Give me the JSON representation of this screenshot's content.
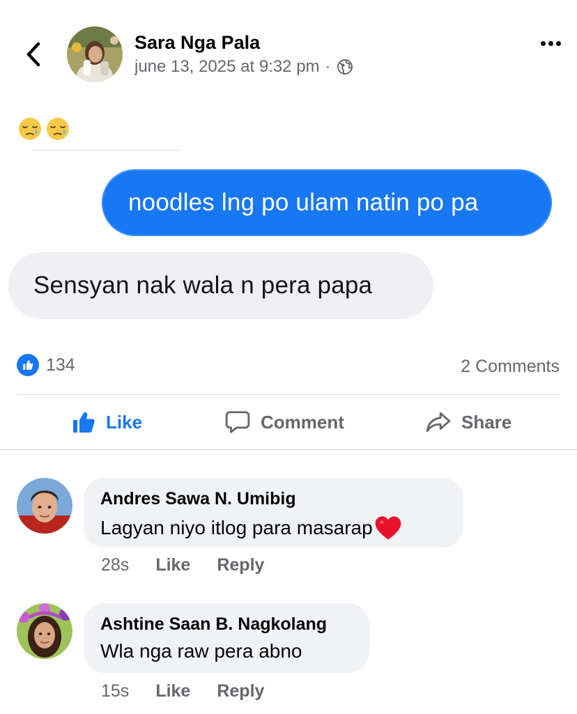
{
  "post": {
    "author_name": "Sara Nga Pala",
    "timestamp": "june 13, 2025 at 9:32 pm",
    "separator": "·",
    "privacy_icon": "globe-icon",
    "text_emojis": [
      "sleepy-face-emoji",
      "sleepy-face-emoji"
    ],
    "image_message_sent": "noodles lng po ulam natin po pa",
    "image_message_received": "Sensyan nak wala n pera papa"
  },
  "reactions": {
    "like_count": "134",
    "comment_count": "2 Comments"
  },
  "actions": {
    "like_label": "Like",
    "comment_label": "Comment",
    "share_label": "Share"
  },
  "comments": [
    {
      "author": "Andres Sawa N. Umibig",
      "text": "Lagyan niyo itlog para masarap",
      "emoji": "red-heart-emoji",
      "time": "28s",
      "like_label": "Like",
      "reply_label": "Reply"
    },
    {
      "author": "Ashtine Saan B. Nagkolang",
      "text": "Wla nga raw pera abno",
      "time": "15s",
      "like_label": "Like",
      "reply_label": "Reply"
    }
  ],
  "colors": {
    "accent_blue": "#1877f2",
    "secondary_text": "#65676b",
    "comment_bg": "#f0f2f5",
    "received_bubble_bg": "#f0eff4"
  }
}
